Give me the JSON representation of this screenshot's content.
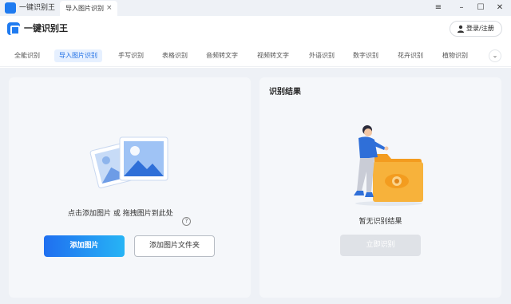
{
  "titlebar": {
    "app_title": "一键识别王",
    "tab_label": "导入图片识别",
    "tab_close": "×",
    "controls": {
      "menu": "≡",
      "minimize": "–",
      "maximize": "☐",
      "close": "✕"
    }
  },
  "header": {
    "brand": "一键识别王",
    "login_label": "登录/注册",
    "logo_icon": "app-logo-icon",
    "user_icon": "user-icon"
  },
  "nav": {
    "items": [
      {
        "label": "全能识别",
        "active": false
      },
      {
        "label": "导入图片识别",
        "active": true
      },
      {
        "label": "手写识别",
        "active": false
      },
      {
        "label": "表格识别",
        "active": false
      },
      {
        "label": "音频转文字",
        "active": false
      },
      {
        "label": "视频转文字",
        "active": false
      },
      {
        "label": "外语识别",
        "active": false
      },
      {
        "label": "数字识别",
        "active": false
      },
      {
        "label": "花卉识别",
        "active": false
      },
      {
        "label": "植物识别",
        "active": false
      }
    ],
    "more": "⌄"
  },
  "left_panel": {
    "drop_hint": "点击添加图片 或 拖拽图片到此处",
    "help": "?",
    "add_image_label": "添加图片",
    "add_folder_label": "添加图片文件夹"
  },
  "right_panel": {
    "title": "识别结果",
    "empty_label": "暂无识别结果",
    "recognize_label": "立即识别"
  },
  "colors": {
    "accent": "#1f6fe5",
    "panel_bg": "#f5f7fa",
    "main_bg": "#eef1f6",
    "folder": "#f7b23b"
  }
}
